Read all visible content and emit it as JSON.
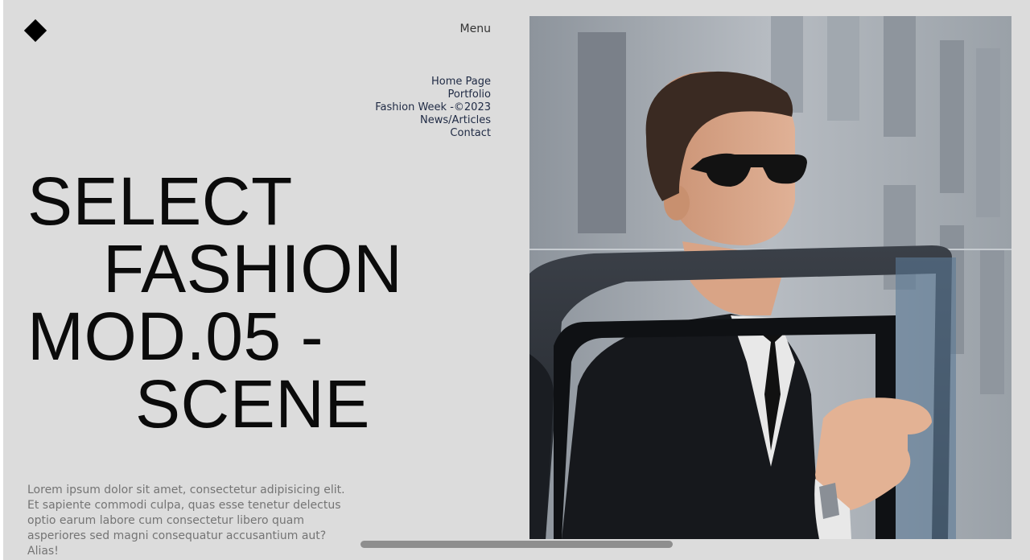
{
  "header": {
    "menu_label": "Menu"
  },
  "nav": {
    "items": [
      {
        "label": "Home Page"
      },
      {
        "label": "Portfolio"
      },
      {
        "label": "Fashion Week -©2023"
      },
      {
        "label": "News/Articles"
      },
      {
        "label": "Contact"
      }
    ]
  },
  "hero": {
    "line1": "SELECT",
    "line2": "FASHION",
    "line3": "MOD.05 -",
    "line4": "SCENE",
    "description": "Lorem ipsum dolor sit amet, consectetur adipisicing elit. Et sapiente commodi culpa, quas esse tenetur delectus optio earum labore cum consectetur libero quam asperiores sed magni consequatur accusantium aut? Alias!"
  },
  "colors": {
    "background": "#dcdcdc",
    "text": "#0b0b0b",
    "muted_text": "#747474",
    "nav_text": "#1f2a44"
  },
  "icons": {
    "logo": "diamond-logo"
  }
}
